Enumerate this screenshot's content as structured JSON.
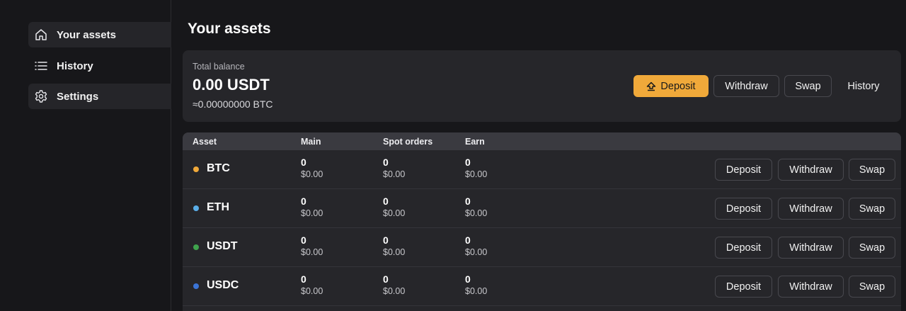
{
  "sidebar": {
    "items": [
      {
        "label": "Your assets",
        "icon": "home-icon"
      },
      {
        "label": "History",
        "icon": "list-icon"
      },
      {
        "label": "Settings",
        "icon": "gear-icon"
      }
    ]
  },
  "page": {
    "title": "Your assets"
  },
  "balance": {
    "label": "Total balance",
    "value": "0.00 USDT",
    "btc": "≈0.00000000 BTC",
    "actions": {
      "deposit": "Deposit",
      "withdraw": "Withdraw",
      "swap": "Swap",
      "history": "History"
    }
  },
  "table": {
    "headers": [
      "Asset",
      "Main",
      "Spot orders",
      "Earn"
    ],
    "rows": [
      {
        "asset": "BTC",
        "color": "#f0a93a",
        "main": "0",
        "main_usd": "$0.00",
        "spot": "0",
        "spot_usd": "$0.00",
        "earn": "0",
        "earn_usd": "$0.00"
      },
      {
        "asset": "ETH",
        "color": "#5aaee8",
        "main": "0",
        "main_usd": "$0.00",
        "spot": "0",
        "spot_usd": "$0.00",
        "earn": "0",
        "earn_usd": "$0.00"
      },
      {
        "asset": "USDT",
        "color": "#3fa34d",
        "main": "0",
        "main_usd": "$0.00",
        "spot": "0",
        "spot_usd": "$0.00",
        "earn": "0",
        "earn_usd": "$0.00"
      },
      {
        "asset": "USDC",
        "color": "#3b74d6",
        "main": "0",
        "main_usd": "$0.00",
        "spot": "0",
        "spot_usd": "$0.00",
        "earn": "0",
        "earn_usd": "$0.00"
      }
    ],
    "row_actions": {
      "deposit": "Deposit",
      "withdraw": "Withdraw",
      "swap": "Swap"
    }
  },
  "colors": {
    "accent": "#f0a93a",
    "background": "#17171a",
    "card": "#26262a"
  }
}
